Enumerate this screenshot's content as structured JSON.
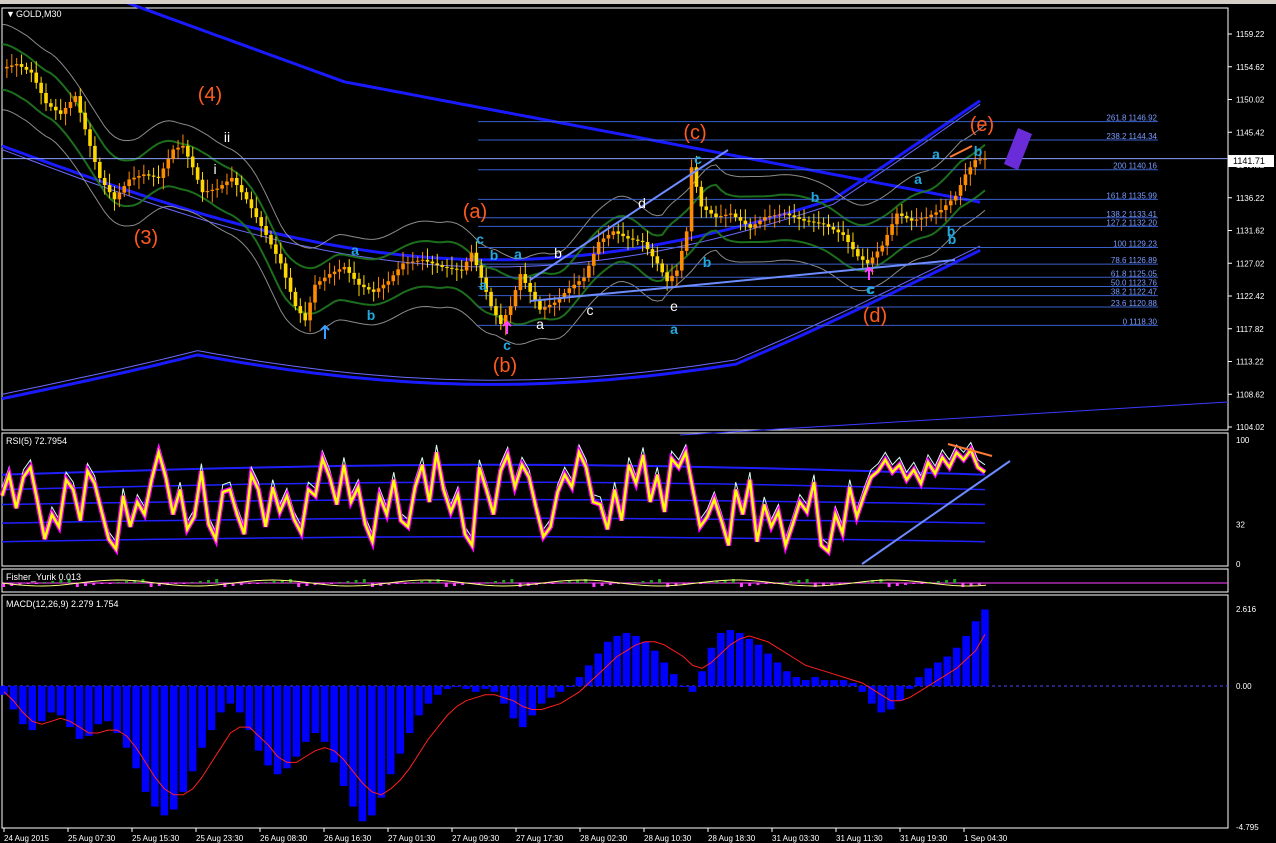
{
  "window": {
    "symbol_label": "GOLD,M30"
  },
  "current_price_tag": "1141.71",
  "rsi_label": "RSI(5) 72.7954",
  "fisher_label": "Fisher_Yurik 0.013",
  "macd_label": "MACD(12,26,9) 2.279 1.754",
  "colors": {
    "background": "#000000",
    "candle_up": "#ff8c00",
    "candle_down": "#ffd700",
    "wave_orange": "#ff5a1f",
    "wave_cyan": "#22a8e0",
    "envelope_blue": "#1a1aff",
    "bands_green": "#1f7a1f",
    "rsi_line": "#ffff00",
    "rsi_outline": "#ff00ff",
    "macd_hist": "#0000ff",
    "macd_signal": "#ff2020",
    "fib": "#3a5fcd"
  },
  "chart_data": [
    {
      "type": "line",
      "panel": "price",
      "symbol": "GOLD",
      "timeframe": "M30",
      "ylim": [
        1104.02,
        1162.0
      ],
      "y_ticks": [
        "1159.22",
        "1154.62",
        "1150.02",
        "1145.42",
        "1140.82",
        "1136.22",
        "1131.62",
        "1127.02",
        "1122.42",
        "1117.82",
        "1113.22",
        "1108.62",
        "1104.02"
      ],
      "x_ticks": [
        "24 Aug 2015",
        "25 Aug 07:30",
        "25 Aug 15:30",
        "25 Aug 23:30",
        "26 Aug 08:30",
        "26 Aug 16:30",
        "27 Aug 01:30",
        "27 Aug 09:30",
        "27 Aug 17:30",
        "28 Aug 02:30",
        "28 Aug 10:30",
        "28 Aug 18:30",
        "31 Aug 03:30",
        "31 Aug 11:30",
        "31 Aug 19:30",
        "1 Sep 04:30"
      ],
      "price_path": [
        [
          0,
          1154.4
        ],
        [
          3,
          1155.0
        ],
        [
          6,
          1153.8
        ],
        [
          9,
          1149.5
        ],
        [
          12,
          1148.0
        ],
        [
          15,
          1150.5
        ],
        [
          18,
          1143.5
        ],
        [
          20,
          1139.0
        ],
        [
          23,
          1136.0
        ],
        [
          26,
          1138.8
        ],
        [
          29,
          1139.5
        ],
        [
          32,
          1139.0
        ],
        [
          35,
          1143.0
        ],
        [
          37,
          1143.5
        ],
        [
          39,
          1140.5
        ],
        [
          41,
          1137.0
        ],
        [
          44,
          1137.5
        ],
        [
          47,
          1139.0
        ],
        [
          50,
          1136.0
        ],
        [
          54,
          1131.0
        ],
        [
          57,
          1127.0
        ],
        [
          60,
          1121.0
        ],
        [
          62,
          1119.0
        ],
        [
          64,
          1124.0
        ],
        [
          67,
          1125.5
        ],
        [
          70,
          1126.5
        ],
        [
          73,
          1124.0
        ],
        [
          76,
          1123.0
        ],
        [
          79,
          1124.5
        ],
        [
          82,
          1127.0
        ],
        [
          86,
          1127.5
        ],
        [
          90,
          1126.5
        ],
        [
          94,
          1126.0
        ],
        [
          96,
          1128.5
        ],
        [
          98,
          1125.0
        ],
        [
          100,
          1121.0
        ],
        [
          102,
          1118.5
        ],
        [
          104,
          1121.0
        ],
        [
          106,
          1125.5
        ],
        [
          108,
          1123.0
        ],
        [
          110,
          1120.5
        ],
        [
          113,
          1121.5
        ],
        [
          116,
          1123.5
        ],
        [
          119,
          1125.0
        ],
        [
          122,
          1130.0
        ],
        [
          125,
          1131.5
        ],
        [
          128,
          1130.5
        ],
        [
          131,
          1130.0
        ],
        [
          134,
          1127.0
        ],
        [
          136,
          1124.5
        ],
        [
          138,
          1126.0
        ],
        [
          140,
          1131.5
        ],
        [
          141,
          1140.5
        ],
        [
          143,
          1135.0
        ],
        [
          146,
          1133.5
        ],
        [
          149,
          1134.0
        ],
        [
          153,
          1132.0
        ],
        [
          156,
          1133.5
        ],
        [
          160,
          1134.0
        ],
        [
          164,
          1133.0
        ],
        [
          168,
          1132.5
        ],
        [
          172,
          1131.0
        ],
        [
          175,
          1128.0
        ],
        [
          177,
          1127.0
        ],
        [
          180,
          1129.5
        ],
        [
          183,
          1134.0
        ],
        [
          186,
          1133.0
        ],
        [
          189,
          1133.5
        ],
        [
          192,
          1134.5
        ],
        [
          195,
          1136.5
        ],
        [
          197,
          1139.5
        ],
        [
          199,
          1141.5
        ],
        [
          201,
          1141.71
        ]
      ],
      "annotations": {
        "waves_orange": [
          "(3)",
          "(4)",
          "(a)",
          "(b)",
          "(c)",
          "(d)",
          "(e)"
        ],
        "waves_cyan": [
          "c",
          "b",
          "a",
          "a",
          "b",
          "c",
          "a",
          "b",
          "a",
          "c",
          "b",
          "a",
          "b",
          "c",
          "b",
          "a",
          "b",
          "c"
        ],
        "waves_white": [
          "i",
          "ii",
          "b",
          "a",
          "c",
          "d",
          "e"
        ]
      },
      "fibonacci_levels": [
        {
          "label": "261.8 1146.92",
          "price": 1146.92
        },
        {
          "label": "238.2 1144.34",
          "price": 1144.34
        },
        {
          "label": "200 1140.16",
          "price": 1140.16
        },
        {
          "label": "161.8 1135.99",
          "price": 1135.99
        },
        {
          "label": "138.2 1133.41",
          "price": 1133.41
        },
        {
          "label": "127.2 1132.20",
          "price": 1132.2
        },
        {
          "label": "100 1129.23",
          "price": 1129.23
        },
        {
          "label": "78.6 1126.89",
          "price": 1126.89
        },
        {
          "label": "61.8 1125.05",
          "price": 1125.05
        },
        {
          "label": "50.0 1123.76",
          "price": 1123.76
        },
        {
          "label": "38.2 1122.47",
          "price": 1122.47
        },
        {
          "label": "23.6 1120.88",
          "price": 1120.88
        },
        {
          "label": "0 1118.30",
          "price": 1118.3
        }
      ]
    },
    {
      "type": "line",
      "panel": "rsi",
      "name": "RSI(5)",
      "last_value": 72.7954,
      "ylim": [
        0,
        100
      ],
      "y_ticks": [
        "100",
        "32",
        "0"
      ],
      "values": [
        55,
        72,
        45,
        70,
        78,
        50,
        20,
        40,
        30,
        68,
        60,
        35,
        75,
        65,
        42,
        20,
        12,
        55,
        30,
        50,
        40,
        68,
        90,
        70,
        40,
        60,
        28,
        38,
        75,
        32,
        20,
        58,
        60,
        40,
        24,
        72,
        60,
        30,
        62,
        42,
        55,
        36,
        25,
        60,
        55,
        85,
        70,
        48,
        80,
        50,
        62,
        32,
        18,
        55,
        40,
        68,
        35,
        30,
        62,
        80,
        50,
        90,
        60,
        42,
        56,
        24,
        15,
        78,
        60,
        40,
        75,
        88,
        62,
        80,
        70,
        45,
        22,
        30,
        58,
        72,
        62,
        90,
        78,
        50,
        48,
        28,
        60,
        35,
        80,
        65,
        88,
        50,
        72,
        42,
        85,
        78,
        90,
        60,
        30,
        38,
        52,
        35,
        15,
        60,
        40,
        68,
        18,
        48,
        30,
        42,
        15,
        32,
        50,
        42,
        66,
        15,
        10,
        40,
        25,
        62,
        38,
        55,
        70,
        75,
        84,
        74,
        80,
        68,
        76,
        65,
        82,
        73,
        86,
        78,
        90,
        84,
        92,
        78,
        74
      ]
    },
    {
      "type": "bar",
      "panel": "macd",
      "name": "MACD(12,26,9)",
      "main_value": 2.279,
      "signal_value": 1.754,
      "ylim": [
        -4.795,
        2.616
      ],
      "y_ticks": [
        "2.616",
        "0.00",
        "-4.795"
      ],
      "histogram": [
        -0.3,
        -0.8,
        -1.3,
        -1.5,
        -1.2,
        -0.9,
        -1.0,
        -1.4,
        -1.8,
        -1.7,
        -1.3,
        -1.2,
        -1.6,
        -2.1,
        -2.8,
        -3.6,
        -4.1,
        -4.4,
        -4.2,
        -3.6,
        -2.9,
        -2.1,
        -1.5,
        -0.9,
        -0.6,
        -0.9,
        -1.5,
        -2.2,
        -2.7,
        -3.0,
        -2.8,
        -2.4,
        -1.9,
        -1.6,
        -1.9,
        -2.6,
        -3.4,
        -4.1,
        -4.6,
        -4.4,
        -3.8,
        -3.0,
        -2.3,
        -1.6,
        -1.0,
        -0.6,
        -0.3,
        -0.1,
        0.0,
        -0.1,
        -0.2,
        -0.1,
        -0.2,
        -0.6,
        -1.1,
        -1.4,
        -1.0,
        -0.6,
        -0.4,
        -0.2,
        0.0,
        0.3,
        0.7,
        1.1,
        1.5,
        1.7,
        1.8,
        1.7,
        1.5,
        1.2,
        0.8,
        0.4,
        0.0,
        -0.2,
        0.5,
        1.3,
        1.8,
        1.9,
        1.8,
        1.6,
        1.4,
        1.1,
        0.8,
        0.5,
        0.3,
        0.2,
        0.3,
        0.2,
        0.2,
        0.2,
        0.1,
        -0.2,
        -0.6,
        -0.9,
        -0.8,
        -0.5,
        -0.1,
        0.3,
        0.6,
        0.8,
        1.0,
        1.3,
        1.7,
        2.2,
        2.6
      ],
      "signal": [
        -0.2,
        -0.5,
        -0.9,
        -1.2,
        -1.3,
        -1.2,
        -1.1,
        -1.2,
        -1.4,
        -1.6,
        -1.6,
        -1.5,
        -1.5,
        -1.7,
        -2.1,
        -2.6,
        -3.1,
        -3.5,
        -3.7,
        -3.7,
        -3.5,
        -3.1,
        -2.6,
        -2.1,
        -1.6,
        -1.4,
        -1.4,
        -1.7,
        -2.0,
        -2.4,
        -2.6,
        -2.6,
        -2.4,
        -2.2,
        -2.1,
        -2.2,
        -2.5,
        -2.9,
        -3.3,
        -3.6,
        -3.7,
        -3.5,
        -3.2,
        -2.8,
        -2.3,
        -1.8,
        -1.4,
        -1.0,
        -0.7,
        -0.5,
        -0.4,
        -0.3,
        -0.3,
        -0.4,
        -0.5,
        -0.7,
        -0.8,
        -0.8,
        -0.7,
        -0.6,
        -0.4,
        -0.2,
        0.1,
        0.4,
        0.7,
        1.0,
        1.2,
        1.4,
        1.5,
        1.5,
        1.4,
        1.2,
        1.0,
        0.7,
        0.6,
        0.8,
        1.1,
        1.4,
        1.6,
        1.7,
        1.6,
        1.5,
        1.3,
        1.1,
        0.9,
        0.7,
        0.6,
        0.5,
        0.4,
        0.3,
        0.2,
        0.1,
        -0.1,
        -0.3,
        -0.5,
        -0.5,
        -0.4,
        -0.2,
        0.0,
        0.2,
        0.4,
        0.6,
        0.9,
        1.2,
        1.754
      ]
    }
  ]
}
